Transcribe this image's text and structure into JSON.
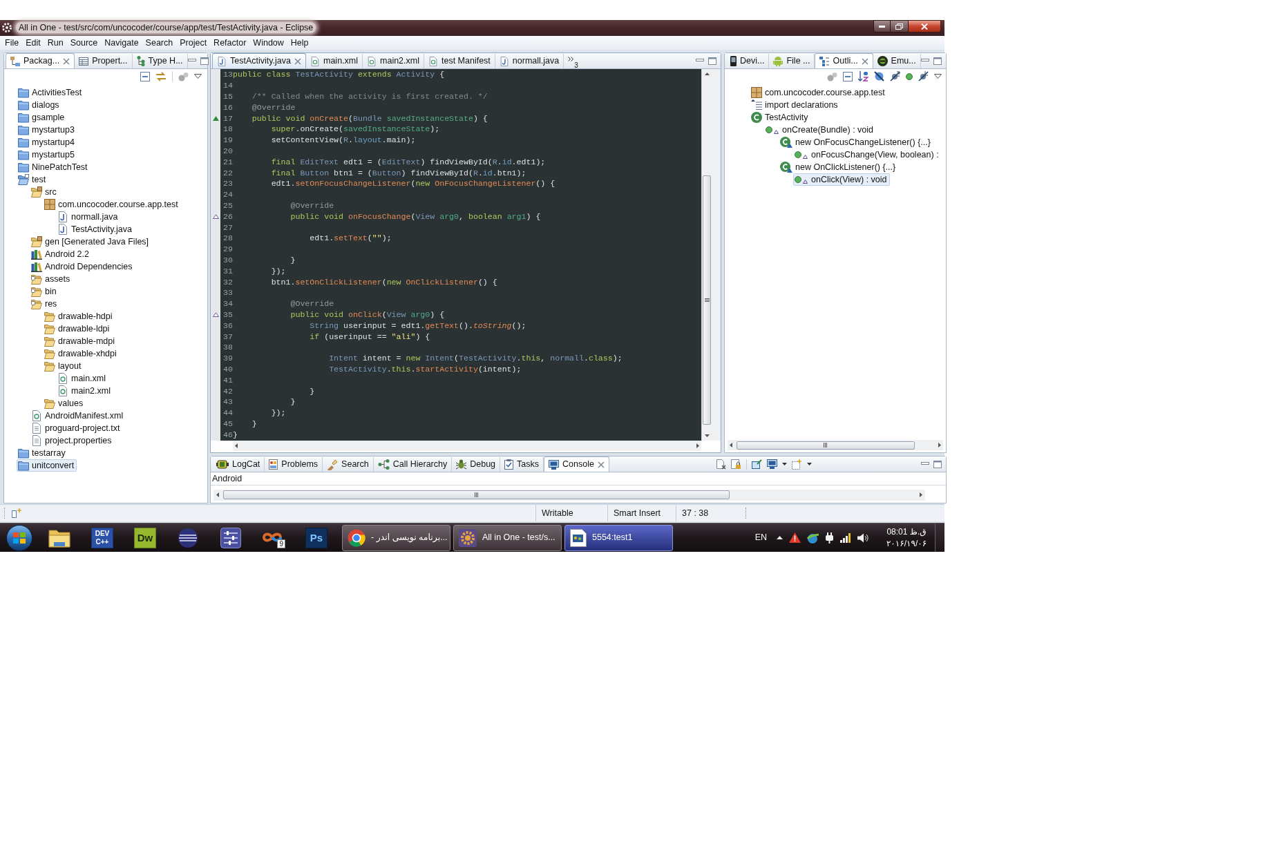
{
  "window": {
    "title": "All in One - test/src/com/uncocoder/course/app/test/TestActivity.java - Eclipse"
  },
  "menu": [
    "File",
    "Edit",
    "Run",
    "Source",
    "Navigate",
    "Search",
    "Project",
    "Refactor",
    "Window",
    "Help"
  ],
  "package_explorer": {
    "tabs": [
      {
        "label": "Packag...",
        "kind": "packages",
        "selected": true
      },
      {
        "label": "Propert...",
        "kind": "properties",
        "selected": false
      },
      {
        "label": "Type H...",
        "kind": "hierarchy",
        "selected": false
      }
    ],
    "items": [
      {
        "label": "ActivitiesTest",
        "kind": "project",
        "selected": false
      },
      {
        "label": "dialogs",
        "kind": "project",
        "selected": false
      },
      {
        "label": "gsample",
        "kind": "project",
        "selected": false
      },
      {
        "label": "mystartup3",
        "kind": "project",
        "selected": false
      },
      {
        "label": "mystartup4",
        "kind": "project",
        "selected": false
      },
      {
        "label": "mystartup5",
        "kind": "project",
        "selected": false
      },
      {
        "label": "NinePatchTest",
        "kind": "project",
        "selected": false
      },
      {
        "label": "test",
        "kind": "open_project",
        "selected": false,
        "children": [
          {
            "label": "src",
            "kind": "source_folder",
            "selected": false,
            "children": [
              {
                "label": "com.uncocoder.course.app.test",
                "kind": "package",
                "selected": false,
                "children": [
                  {
                    "label": "normall.java",
                    "kind": "java_file",
                    "selected": false
                  },
                  {
                    "label": "TestActivity.java",
                    "kind": "java_file",
                    "selected": false
                  }
                ]
              }
            ]
          },
          {
            "label": "gen [Generated Java Files]",
            "kind": "source_folder",
            "selected": false
          },
          {
            "label": "Android 2.2",
            "kind": "library",
            "selected": false
          },
          {
            "label": "Android Dependencies",
            "kind": "library",
            "selected": false
          },
          {
            "label": "assets",
            "kind": "android_folder",
            "selected": false
          },
          {
            "label": "bin",
            "kind": "android_folder",
            "selected": false
          },
          {
            "label": "res",
            "kind": "android_folder",
            "selected": false,
            "children": [
              {
                "label": "drawable-hdpi",
                "kind": "folder",
                "selected": false
              },
              {
                "label": "drawable-ldpi",
                "kind": "folder",
                "selected": false
              },
              {
                "label": "drawable-mdpi",
                "kind": "folder",
                "selected": false
              },
              {
                "label": "drawable-xhdpi",
                "kind": "folder",
                "selected": false
              },
              {
                "label": "layout",
                "kind": "folder",
                "selected": false,
                "children": [
                  {
                    "label": "main.xml",
                    "kind": "xml_file",
                    "selected": false
                  },
                  {
                    "label": "main2.xml",
                    "kind": "xml_file",
                    "selected": false
                  }
                ]
              },
              {
                "label": "values",
                "kind": "folder",
                "selected": false
              }
            ]
          },
          {
            "label": "AndroidManifest.xml",
            "kind": "xml_file",
            "selected": false
          },
          {
            "label": "proguard-project.txt",
            "kind": "text_file",
            "selected": false
          },
          {
            "label": "project.properties",
            "kind": "text_file",
            "selected": false
          }
        ]
      },
      {
        "label": "testarray",
        "kind": "project",
        "selected": false
      },
      {
        "label": "unitconvert",
        "kind": "project",
        "selected": true
      }
    ]
  },
  "editor": {
    "tabs": [
      {
        "label": "TestActivity.java",
        "kind": "java",
        "selected": true
      },
      {
        "label": "main.xml",
        "kind": "xml",
        "selected": false
      },
      {
        "label": "main2.xml",
        "kind": "xml",
        "selected": false
      },
      {
        "label": "test Manifest",
        "kind": "xml",
        "selected": false
      },
      {
        "label": "normall.java",
        "kind": "java",
        "selected": false
      }
    ],
    "overflow_count": "3",
    "lines": [
      {
        "number": "13",
        "overrides": false,
        "implements": false,
        "tokens": [
          {
            "kind": "keyword",
            "text": "public class "
          },
          {
            "kind": "type",
            "text": "TestActivity "
          },
          {
            "kind": "keyword",
            "text": "extends "
          },
          {
            "kind": "type",
            "text": "Activity "
          },
          {
            "kind": "plain",
            "text": "{"
          }
        ]
      },
      {
        "number": "14",
        "overrides": false,
        "implements": false
      },
      {
        "number": "15",
        "overrides": false,
        "implements": false,
        "tokens": [
          {
            "kind": "comment",
            "text": "    /** Called when the activity is first created. */"
          }
        ]
      },
      {
        "number": "16",
        "overrides": false,
        "implements": false,
        "tokens": [
          {
            "kind": "annotation",
            "text": "    @Override"
          }
        ]
      },
      {
        "number": "17",
        "overrides": true,
        "implements": false,
        "tokens": [
          {
            "kind": "keyword",
            "text": "    public void "
          },
          {
            "kind": "method",
            "text": "onCreate"
          },
          {
            "kind": "plain",
            "text": "("
          },
          {
            "kind": "type",
            "text": "Bundle "
          },
          {
            "kind": "param",
            "text": "savedInstanceState"
          },
          {
            "kind": "plain",
            "text": ") {"
          }
        ]
      },
      {
        "number": "18",
        "overrides": false,
        "implements": false,
        "tokens": [
          {
            "kind": "keyword",
            "text": "        super"
          },
          {
            "kind": "plain",
            "text": ".onCreate("
          },
          {
            "kind": "param",
            "text": "savedInstanceState"
          },
          {
            "kind": "plain",
            "text": ");"
          }
        ]
      },
      {
        "number": "19",
        "overrides": false,
        "implements": false,
        "tokens": [
          {
            "kind": "plain",
            "text": "        setContentView("
          },
          {
            "kind": "type",
            "text": "R"
          },
          {
            "kind": "plain",
            "text": "."
          },
          {
            "kind": "field",
            "text": "layout"
          },
          {
            "kind": "plain",
            "text": ".main);"
          }
        ]
      },
      {
        "number": "20",
        "overrides": false,
        "implements": false
      },
      {
        "number": "21",
        "overrides": false,
        "implements": false,
        "tokens": [
          {
            "kind": "keyword",
            "text": "        final "
          },
          {
            "kind": "type",
            "text": "EditText "
          },
          {
            "kind": "plain",
            "text": "edt1 = ("
          },
          {
            "kind": "type",
            "text": "EditText"
          },
          {
            "kind": "plain",
            "text": ") findViewById("
          },
          {
            "kind": "type",
            "text": "R"
          },
          {
            "kind": "plain",
            "text": "."
          },
          {
            "kind": "field",
            "text": "id"
          },
          {
            "kind": "plain",
            "text": ".edt1);"
          }
        ]
      },
      {
        "number": "22",
        "overrides": false,
        "implements": false,
        "tokens": [
          {
            "kind": "keyword",
            "text": "        final "
          },
          {
            "kind": "type",
            "text": "Button "
          },
          {
            "kind": "plain",
            "text": "btn1 = ("
          },
          {
            "kind": "type",
            "text": "Button"
          },
          {
            "kind": "plain",
            "text": ") findViewById("
          },
          {
            "kind": "type",
            "text": "R"
          },
          {
            "kind": "plain",
            "text": "."
          },
          {
            "kind": "field",
            "text": "id"
          },
          {
            "kind": "plain",
            "text": ".btn1);"
          }
        ]
      },
      {
        "number": "23",
        "overrides": false,
        "implements": false,
        "tokens": [
          {
            "kind": "plain",
            "text": "        edt1."
          },
          {
            "kind": "method",
            "text": "setOnFocusChangeListener"
          },
          {
            "kind": "plain",
            "text": "("
          },
          {
            "kind": "keyword",
            "text": "new "
          },
          {
            "kind": "method",
            "text": "OnFocusChangeListener"
          },
          {
            "kind": "plain",
            "text": "() {"
          }
        ]
      },
      {
        "number": "24",
        "overrides": false,
        "implements": false
      },
      {
        "number": "25",
        "overrides": false,
        "implements": false,
        "tokens": [
          {
            "kind": "annotation",
            "text": "            @Override"
          }
        ]
      },
      {
        "number": "26",
        "overrides": false,
        "implements": true,
        "tokens": [
          {
            "kind": "keyword",
            "text": "            public void "
          },
          {
            "kind": "method",
            "text": "onFocusChange"
          },
          {
            "kind": "plain",
            "text": "("
          },
          {
            "kind": "type",
            "text": "View "
          },
          {
            "kind": "param",
            "text": "arg0"
          },
          {
            "kind": "plain",
            "text": ", "
          },
          {
            "kind": "keyword",
            "text": "boolean "
          },
          {
            "kind": "param",
            "text": "arg1"
          },
          {
            "kind": "plain",
            "text": ") {"
          }
        ]
      },
      {
        "number": "27",
        "overrides": false,
        "implements": false
      },
      {
        "number": "28",
        "overrides": false,
        "implements": false,
        "tokens": [
          {
            "kind": "plain",
            "text": "                edt1."
          },
          {
            "kind": "method",
            "text": "setText"
          },
          {
            "kind": "plain",
            "text": "("
          },
          {
            "kind": "string",
            "text": "\"\""
          },
          {
            "kind": "plain",
            "text": ");"
          }
        ]
      },
      {
        "number": "29",
        "overrides": false,
        "implements": false
      },
      {
        "number": "30",
        "overrides": false,
        "implements": false,
        "tokens": [
          {
            "kind": "plain",
            "text": "            }"
          }
        ]
      },
      {
        "number": "31",
        "overrides": false,
        "implements": false,
        "tokens": [
          {
            "kind": "plain",
            "text": "        });"
          }
        ]
      },
      {
        "number": "32",
        "overrides": false,
        "implements": false,
        "tokens": [
          {
            "kind": "plain",
            "text": "        btn1."
          },
          {
            "kind": "method",
            "text": "setOnClickListener"
          },
          {
            "kind": "plain",
            "text": "("
          },
          {
            "kind": "keyword",
            "text": "new "
          },
          {
            "kind": "method",
            "text": "OnClickListener"
          },
          {
            "kind": "plain",
            "text": "() {"
          }
        ]
      },
      {
        "number": "33",
        "overrides": false,
        "implements": false
      },
      {
        "number": "34",
        "overrides": false,
        "implements": false,
        "tokens": [
          {
            "kind": "annotation",
            "text": "            @Override"
          }
        ]
      },
      {
        "number": "35",
        "overrides": false,
        "implements": true,
        "tokens": [
          {
            "kind": "keyword",
            "text": "            public void "
          },
          {
            "kind": "method",
            "text": "onClick"
          },
          {
            "kind": "plain",
            "text": "("
          },
          {
            "kind": "type",
            "text": "View "
          },
          {
            "kind": "param",
            "text": "arg0"
          },
          {
            "kind": "plain",
            "text": ") {"
          }
        ]
      },
      {
        "number": "36",
        "overrides": false,
        "implements": false,
        "tokens": [
          {
            "kind": "type",
            "text": "                String "
          },
          {
            "kind": "plain",
            "text": "userinput = edt1."
          },
          {
            "kind": "method",
            "text": "getText"
          },
          {
            "kind": "plain",
            "text": "()."
          },
          {
            "kind": "inherited_method",
            "text": "toString"
          },
          {
            "kind": "plain",
            "text": "();"
          }
        ]
      },
      {
        "number": "37",
        "overrides": false,
        "implements": false,
        "tokens": [
          {
            "kind": "keyword",
            "text": "                if "
          },
          {
            "kind": "plain",
            "text": "(userinput == "
          },
          {
            "kind": "string",
            "text": "\"ali\""
          },
          {
            "kind": "plain",
            "text": ") {"
          }
        ]
      },
      {
        "number": "38",
        "overrides": false,
        "implements": false
      },
      {
        "number": "39",
        "overrides": false,
        "implements": false,
        "tokens": [
          {
            "kind": "type",
            "text": "                    Intent "
          },
          {
            "kind": "plain",
            "text": "intent = "
          },
          {
            "kind": "keyword",
            "text": "new "
          },
          {
            "kind": "type",
            "text": "Intent"
          },
          {
            "kind": "plain",
            "text": "("
          },
          {
            "kind": "type",
            "text": "TestActivity"
          },
          {
            "kind": "plain",
            "text": "."
          },
          {
            "kind": "keyword",
            "text": "this"
          },
          {
            "kind": "plain",
            "text": ", "
          },
          {
            "kind": "type",
            "text": "normall"
          },
          {
            "kind": "plain",
            "text": "."
          },
          {
            "kind": "keyword",
            "text": "class"
          },
          {
            "kind": "plain",
            "text": ");"
          }
        ]
      },
      {
        "number": "40",
        "overrides": false,
        "implements": false,
        "tokens": [
          {
            "kind": "type",
            "text": "                    TestActivity"
          },
          {
            "kind": "plain",
            "text": "."
          },
          {
            "kind": "keyword",
            "text": "this"
          },
          {
            "kind": "plain",
            "text": "."
          },
          {
            "kind": "method",
            "text": "startActivity"
          },
          {
            "kind": "plain",
            "text": "(intent);"
          }
        ]
      },
      {
        "number": "41",
        "overrides": false,
        "implements": false
      },
      {
        "number": "42",
        "overrides": false,
        "implements": false,
        "tokens": [
          {
            "kind": "plain",
            "text": "                }"
          }
        ]
      },
      {
        "number": "43",
        "overrides": false,
        "implements": false,
        "tokens": [
          {
            "kind": "plain",
            "text": "            }"
          }
        ]
      },
      {
        "number": "44",
        "overrides": false,
        "implements": false,
        "tokens": [
          {
            "kind": "plain",
            "text": "        });"
          }
        ]
      },
      {
        "number": "45",
        "overrides": false,
        "implements": false,
        "tokens": [
          {
            "kind": "plain",
            "text": "    }"
          }
        ]
      },
      {
        "number": "46",
        "overrides": false,
        "implements": false,
        "tokens": [
          {
            "kind": "plain",
            "text": "}"
          }
        ]
      }
    ]
  },
  "outline_view": {
    "tabs": [
      {
        "label": "Devi...",
        "kind": "device",
        "selected": false
      },
      {
        "label": "File ...",
        "kind": "android",
        "selected": false
      },
      {
        "label": "Outli...",
        "kind": "outline",
        "selected": true
      },
      {
        "label": "Emu...",
        "kind": "emulator",
        "selected": false
      }
    ],
    "items": [
      {
        "label": "com.uncocoder.course.app.test",
        "kind": "package",
        "selected": false
      },
      {
        "label": "import declarations",
        "kind": "imports",
        "selected": false
      },
      {
        "label": "TestActivity",
        "kind": "class",
        "selected": false,
        "children": [
          {
            "label": "onCreate(Bundle) : void",
            "kind": "method",
            "selected": false,
            "children": [
              {
                "label": "new OnFocusChangeListener() {...}",
                "kind": "anonymous_class",
                "selected": false,
                "children": [
                  {
                    "label": "onFocusChange(View, boolean) :",
                    "kind": "method",
                    "selected": false
                  }
                ]
              },
              {
                "label": "new OnClickListener() {...}",
                "kind": "anonymous_class",
                "selected": false,
                "children": [
                  {
                    "label": "onClick(View) : void",
                    "kind": "method",
                    "selected": true
                  }
                ]
              }
            ]
          }
        ]
      }
    ]
  },
  "console_view": {
    "tabs": [
      {
        "label": "LogCat",
        "kind": "logcat",
        "selected": false
      },
      {
        "label": "Problems",
        "kind": "problems",
        "selected": false
      },
      {
        "label": "Search",
        "kind": "search",
        "selected": false
      },
      {
        "label": "Call Hierarchy",
        "kind": "call_hierarchy",
        "selected": false
      },
      {
        "label": "Debug",
        "kind": "debug",
        "selected": false
      },
      {
        "label": "Tasks",
        "kind": "tasks",
        "selected": false
      },
      {
        "label": "Console",
        "kind": "console",
        "selected": true
      }
    ],
    "console_name": "Android"
  },
  "status_bar": {
    "fields": [
      "Writable",
      "Smart Insert",
      "37 : 38"
    ]
  },
  "taskbar": {
    "pinned": [
      {
        "kind": "folder"
      },
      {
        "kind": "tile",
        "lines": [
          "DEV",
          "C++"
        ],
        "color": "#2b52a8"
      },
      {
        "kind": "tile",
        "lines": [
          "Dw"
        ],
        "color": "#95b82e"
      },
      {
        "kind": "sphere"
      },
      {
        "kind": "mixer"
      },
      {
        "kind": "badge_app",
        "badge": "9"
      },
      {
        "kind": "tile",
        "lines": [
          "Ps"
        ],
        "color": "#0f2f5c"
      }
    ],
    "tasks": [
      {
        "label": "...برنامه نویسی اندر -",
        "kind": "browser",
        "selected": false
      },
      {
        "label": "All in One - test/s...",
        "kind": "ide",
        "selected": false
      },
      {
        "label": "5554:test1",
        "kind": "window",
        "selected": true
      }
    ],
    "language": "EN",
    "clock": {
      "time": "08:01 ق.ظ",
      "date": "۲۰۱۶/۱۹/۰۶"
    }
  }
}
